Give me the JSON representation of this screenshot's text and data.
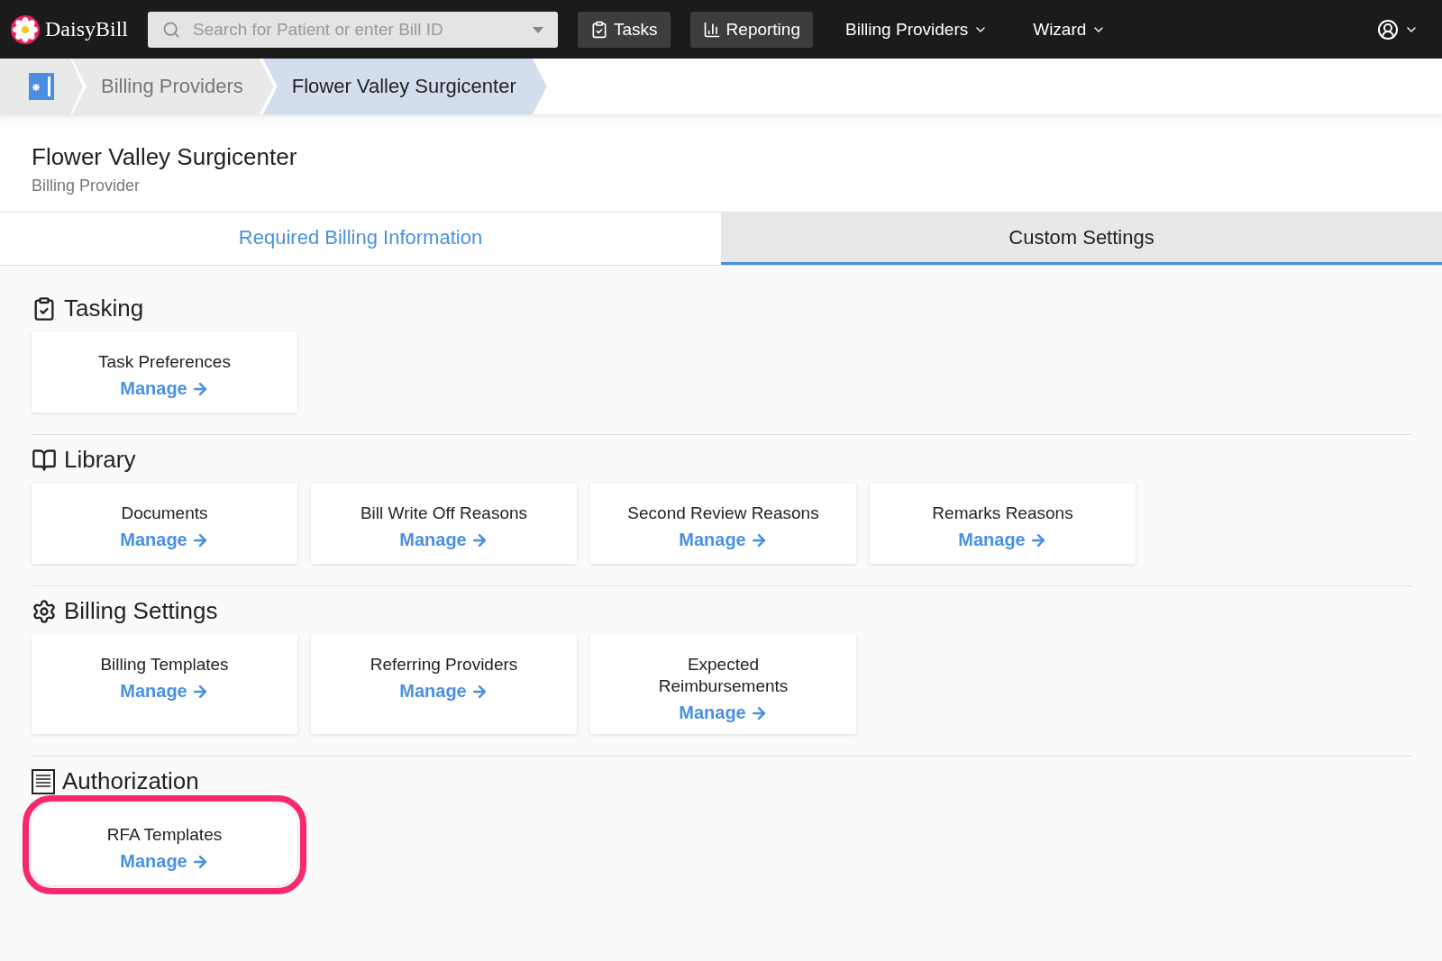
{
  "topbar": {
    "brand": "DaisyBill",
    "search": {
      "placeholder": "Search for Patient or enter Bill ID"
    },
    "nav": [
      {
        "label": "Tasks",
        "kind": "tasks"
      },
      {
        "label": "Reporting",
        "kind": "reporting"
      },
      {
        "label": "Billing Providers",
        "kind": "menu"
      },
      {
        "label": "Wizard",
        "kind": "menu"
      }
    ]
  },
  "breadcrumb": [
    {
      "label": "Billing Providers",
      "selected": false
    },
    {
      "label": "Flower Valley Surgicenter",
      "selected": true
    }
  ],
  "header": {
    "title": "Flower Valley Surgicenter",
    "subtitle": "Billing Provider"
  },
  "tabs": [
    {
      "label": "Required Billing Information",
      "selected": false
    },
    {
      "label": "Custom Settings",
      "selected": true
    }
  ],
  "sections": [
    {
      "title": "Tasking",
      "kind": "tasking",
      "cards": [
        {
          "title": "Task Preferences",
          "link": "Manage",
          "highlighted": false
        }
      ]
    },
    {
      "title": "Library",
      "kind": "library",
      "cards": [
        {
          "title": "Documents",
          "link": "Manage",
          "highlighted": false
        },
        {
          "title": "Bill Write Off Reasons",
          "link": "Manage",
          "highlighted": false
        },
        {
          "title": "Second Review Reasons",
          "link": "Manage",
          "highlighted": false
        },
        {
          "title": "Remarks Reasons",
          "link": "Manage",
          "highlighted": false
        }
      ]
    },
    {
      "title": "Billing Settings",
      "kind": "settings",
      "cards": [
        {
          "title": "Billing Templates",
          "link": "Manage",
          "highlighted": false
        },
        {
          "title": "Referring Providers",
          "link": "Manage",
          "highlighted": false
        },
        {
          "title": "Expected Reimbursements",
          "link": "Manage",
          "highlighted": false
        }
      ]
    },
    {
      "title": "Authorization",
      "kind": "authorization",
      "cards": [
        {
          "title": "RFA Templates",
          "link": "Manage",
          "highlighted": true
        }
      ]
    }
  ]
}
